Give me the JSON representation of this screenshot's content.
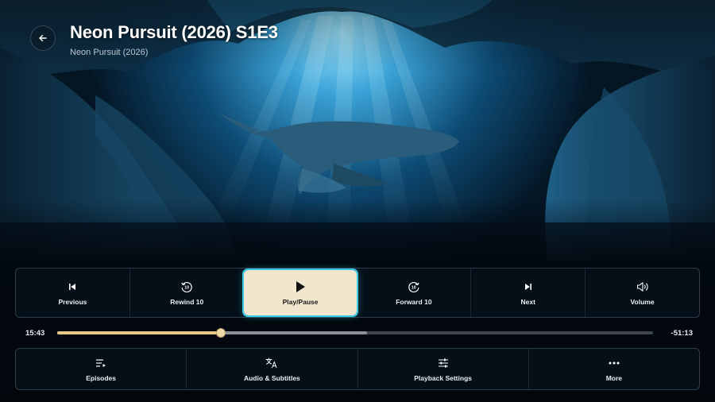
{
  "header": {
    "title": "Neon Pursuit (2026) S1E3",
    "subtitle": "Neon Pursuit (2026)",
    "back_icon": "arrow-left-icon"
  },
  "controls": [
    {
      "label": "Previous",
      "icon": "skip-previous-icon"
    },
    {
      "label": "Rewind 10",
      "icon": "rewind-10-icon"
    },
    {
      "label": "Play/Pause",
      "icon": "play-icon",
      "focused": true
    },
    {
      "label": "Forward 10",
      "icon": "forward-10-icon"
    },
    {
      "label": "Next",
      "icon": "skip-next-icon"
    },
    {
      "label": "Volume",
      "icon": "volume-icon"
    }
  ],
  "progress": {
    "elapsed": "15:43",
    "remaining": "-51:13",
    "played_fraction": 0.275,
    "buffered_fraction": 0.52
  },
  "options": [
    {
      "label": "Episodes",
      "icon": "episodes-list-icon"
    },
    {
      "label": "Audio & Subtitles",
      "icon": "translate-icon"
    },
    {
      "label": "Playback Settings",
      "icon": "sliders-icon"
    },
    {
      "label": "More",
      "icon": "more-dots-icon"
    }
  ],
  "colors": {
    "focus_fill": "#f2e6cf",
    "focus_outline": "#38c9e3",
    "progress_played": "#e9c98a"
  }
}
